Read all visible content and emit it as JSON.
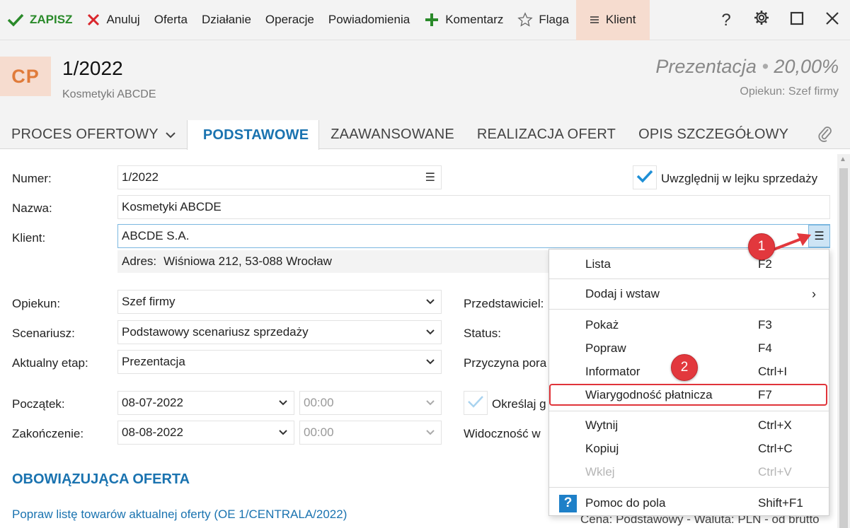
{
  "toolbar": {
    "save": "ZAPISZ",
    "cancel": "Anuluj",
    "offer": "Oferta",
    "action": "Działanie",
    "operations": "Operacje",
    "notifications": "Powiadomienia",
    "comment": "Komentarz",
    "flag": "Flaga",
    "client": "Klient",
    "help": "?"
  },
  "header": {
    "badge": "CP",
    "number": "1/2022",
    "subtitle": "Kosmetyki ABCDE",
    "stage": "Prezentacja",
    "stage_sep": "•",
    "percent": "20,00%",
    "owner": "Opiekun: Szef firmy"
  },
  "tabs": [
    "PROCES OFERTOWY",
    "PODSTAWOWE",
    "ZAAWANSOWANE",
    "REALIZACJA OFERT",
    "OPIS SZCZEGÓŁOWY"
  ],
  "form": {
    "numer_label": "Numer:",
    "numer_value": "1/2022",
    "include_label": "Uwzględnij w lejku sprzedaży",
    "nazwa_label": "Nazwa:",
    "nazwa_value": "Kosmetyki ABCDE",
    "klient_label": "Klient:",
    "klient_value": "ABCDE S.A.",
    "adres_prefix": "Adres:",
    "adres_value": "Wiśniowa 212, 53-088 Wrocław",
    "opiekun_label": "Opiekun:",
    "opiekun_value": "Szef firmy",
    "przedstawiciel_label": "Przedstawiciel:",
    "scenariusz_label": "Scenariusz:",
    "scenariusz_value": "Podstawowy scenariusz sprzedaży",
    "status_label": "Status:",
    "etap_label": "Aktualny etap:",
    "etap_value": "Prezentacja",
    "przyczyna_label": "Przyczyna pora",
    "poczatek_label": "Początek:",
    "poczatek_date": "08-07-2022",
    "poczatek_time": "00:00",
    "okreslaj_label": "Określaj g",
    "zakonczenie_label": "Zakończenie:",
    "zakonczenie_date": "08-08-2022",
    "zakonczenie_time": "00:00",
    "widocznosc_label": "Widoczność w"
  },
  "section": {
    "title": "OBOWIĄZUJĄCA OFERTA",
    "link": "Popraw listę towarów aktualnej oferty (OE 1/CENTRALA/2022)",
    "behind": "Cena: Podstawowy - Waluta: PLN - od brutto"
  },
  "context_menu": {
    "items": [
      {
        "label": "Lista",
        "key": "F2"
      },
      {
        "label": "Dodaj i wstaw",
        "key": ""
      },
      {
        "label": "Pokaż",
        "key": "F3"
      },
      {
        "label": "Popraw",
        "key": "F4"
      },
      {
        "label": "Informator",
        "key": "Ctrl+I"
      },
      {
        "label": "Wiarygodność płatnicza",
        "key": "F7"
      },
      {
        "label": "Wytnij",
        "key": "Ctrl+X"
      },
      {
        "label": "Kopiuj",
        "key": "Ctrl+C"
      },
      {
        "label": "Wklej",
        "key": "Ctrl+V"
      },
      {
        "label": "Pomoc do pola",
        "key": "Shift+F1"
      }
    ],
    "submenu_arrow": "›"
  },
  "annotations": {
    "step1": "1",
    "step2": "2"
  },
  "colors": {
    "accent": "#1a73b0",
    "badge_bg": "#f6dccf",
    "badge_text": "#e07b3a",
    "save_green": "#2a8a2a",
    "highlight_red": "#e0343a"
  }
}
